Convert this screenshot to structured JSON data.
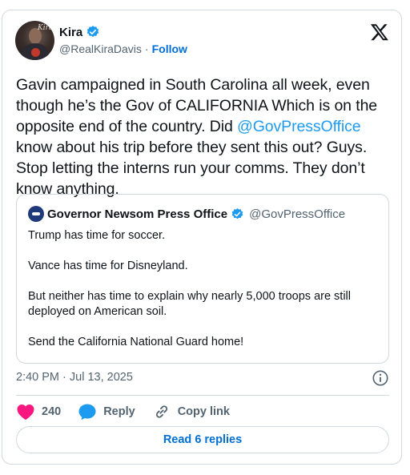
{
  "author": {
    "name": "Kira",
    "handle": "@RealKiraDavis",
    "separator": "·",
    "follow_label": "Follow",
    "avatar_scribble": "Kira"
  },
  "tweet": {
    "text_before_mention": "Gavin campaigned in South Carolina all week, even though he’s the Gov of CALIFORNIA  Which is on the opposite end of the country. Did ",
    "mention": "@GovPressOffice",
    "text_after_mention": " know about his trip before they sent this out? Guys. Stop letting the interns run your comms. They don’t know anything.",
    "timestamp": "2:40 PM · Jul 13, 2025"
  },
  "quote": {
    "name": "Governor Newsom Press Office",
    "handle": "@GovPressOffice",
    "paragraphs": [
      "Trump has time for soccer.",
      "Vance has time for Disneyland.",
      "But neither has time to explain why nearly 5,000 troops are still deployed on American soil.",
      "Send the California National Guard home!"
    ]
  },
  "actions": {
    "like_count": "240",
    "reply_label": "Reply",
    "copy_link_label": "Copy link",
    "read_replies_label": "Read 6 replies"
  },
  "colors": {
    "accent": "#1d9bf0",
    "like": "#f91880",
    "gov_badge": "#829aab"
  },
  "icons": [
    "verified-badge-icon",
    "x-logo-icon",
    "gov-verified-badge-icon",
    "info-icon",
    "heart-icon",
    "reply-bubble-icon",
    "link-icon"
  ]
}
